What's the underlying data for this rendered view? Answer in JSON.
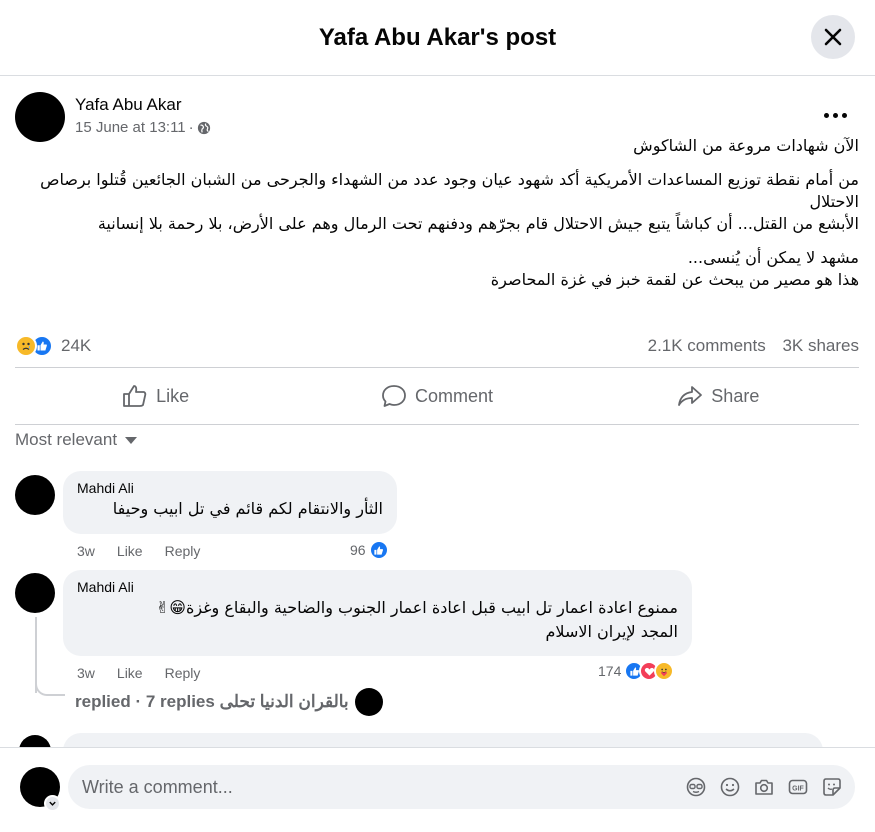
{
  "header": {
    "title": "Yafa Abu Akar's post",
    "close_icon": "close-icon"
  },
  "post": {
    "author": "Yafa Abu Akar",
    "time": "15 June at 13:11",
    "separator": "·",
    "privacy_icon": "globe-icon",
    "paragraphs": [
      "الآن شهادات مروعة من الشاكوش",
      "من أمام نقطة توزيع المساعدات الأمريكية أكد شهود عيان وجود عدد من الشهداء والجرحى من الشبان الجائعين قُتلوا برصاص الاحتلال",
      "الأبشع من القتل... أن  كباشاً يتبع جيش الاحتلال قام بجرّهم ودفنهم تحت الرمال وهم على الأرض، بلا رحمة بلا إنسانية",
      "مشهد لا يمكن أن يُنسى...",
      "هذا هو مصير من يبحث عن لقمة خبز في غزة المحاصرة"
    ],
    "reaction_count": "24K",
    "comments_count": "2.1K comments",
    "shares_count": "3K shares"
  },
  "actions": {
    "like": "Like",
    "comment": "Comment",
    "share": "Share"
  },
  "sort_label": "Most relevant",
  "comments": [
    {
      "name": "Mahdi Ali",
      "text": "الثأر والانتقام لكم قائم في تل ابيب وحيفا",
      "time": "3w",
      "like": "Like",
      "reply": "Reply",
      "reactions": "96"
    },
    {
      "name": "Mahdi Ali",
      "text_line1": "ممنوع اعادة اعمار تل ابيب قبل اعادة اعمار الجنوب والضاحية والبقاع وغزة😁✌",
      "text_line2": "المجد لإيران الاسلام",
      "time": "3w",
      "like": "Like",
      "reply": "Reply",
      "reactions": "174"
    }
  ],
  "replies_summary": "بالقران الدنيا تحلى replied · 7 replies",
  "composer": {
    "placeholder": "Write a comment..."
  },
  "colors": {
    "accent": "#1877f2",
    "muted": "#65676b",
    "bubble": "#f0f2f5"
  }
}
